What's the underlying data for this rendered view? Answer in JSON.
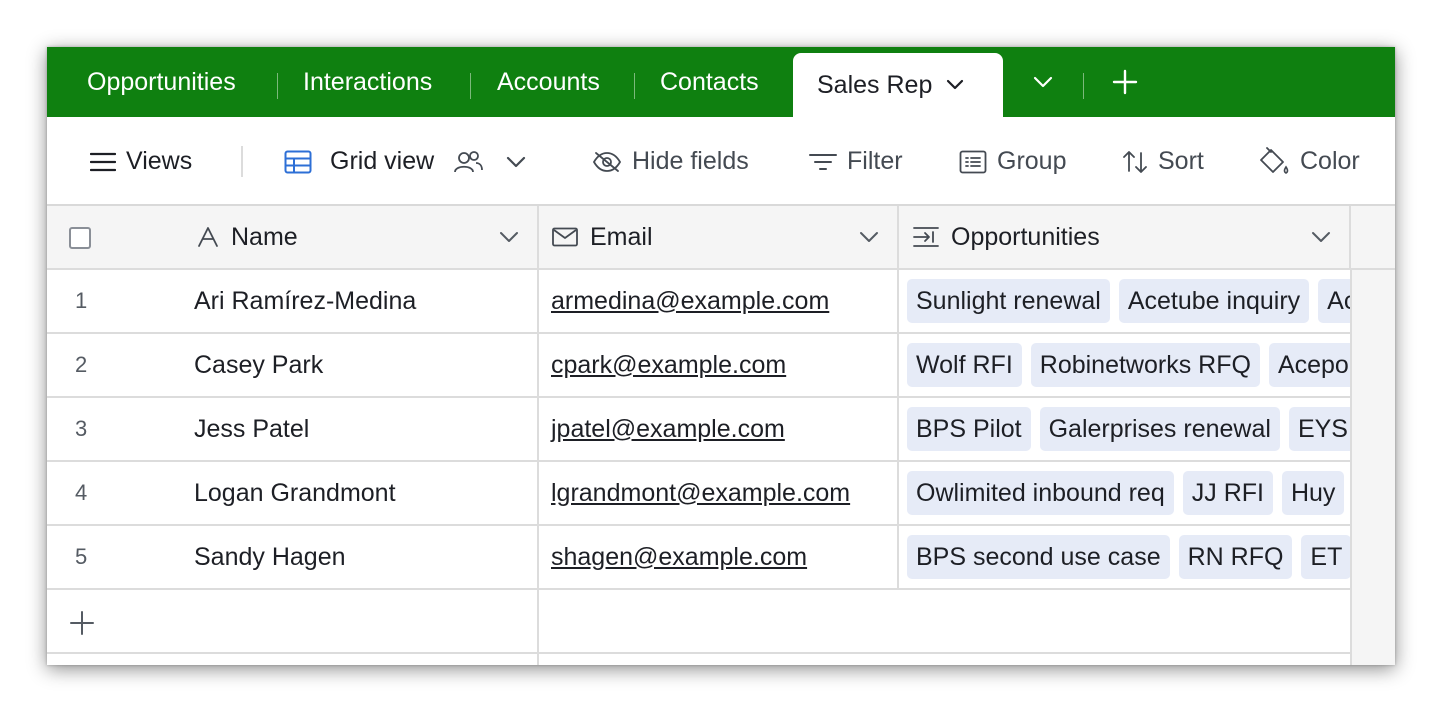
{
  "tabs": [
    {
      "label": "Opportunities"
    },
    {
      "label": "Interactions"
    },
    {
      "label": "Accounts"
    },
    {
      "label": "Contacts"
    },
    {
      "label": "Sales Rep",
      "active": true
    }
  ],
  "toolbar": {
    "views_label": "Views",
    "grid_view_label": "Grid view",
    "hide_fields_label": "Hide fields",
    "filter_label": "Filter",
    "group_label": "Group",
    "sort_label": "Sort",
    "color_label": "Color"
  },
  "columns": {
    "name": "Name",
    "email": "Email",
    "opportunities": "Opportunities"
  },
  "rows": [
    {
      "num": "1",
      "name": "Ari Ramírez-Medina",
      "email": "armedina@example.com",
      "opportunities": [
        "Sunlight renewal",
        "Acetube inquiry",
        "Acetube inquiry"
      ]
    },
    {
      "num": "2",
      "name": "Casey Park",
      "email": "cpark@example.com",
      "opportunities": [
        "Wolf RFI",
        "Robinetworks RFQ",
        "Acepoint"
      ]
    },
    {
      "num": "3",
      "name": "Jess Patel",
      "email": "jpatel@example.com",
      "opportunities": [
        "BPS Pilot",
        "Galerprises renewal",
        "EYS"
      ]
    },
    {
      "num": "4",
      "name": "Logan Grandmont",
      "email": "lgrandmont@example.com",
      "opportunities": [
        "Owlimited inbound req",
        "JJ RFI",
        "Huy"
      ]
    },
    {
      "num": "5",
      "name": "Sandy Hagen",
      "email": "shagen@example.com",
      "opportunities": [
        "BPS second use case",
        "RN RFQ",
        "ET"
      ]
    }
  ],
  "colors": {
    "brand_green": "#0f8010",
    "grid_view_icon": "#2d6fd6",
    "chip_bg": "#e6ebf7"
  }
}
